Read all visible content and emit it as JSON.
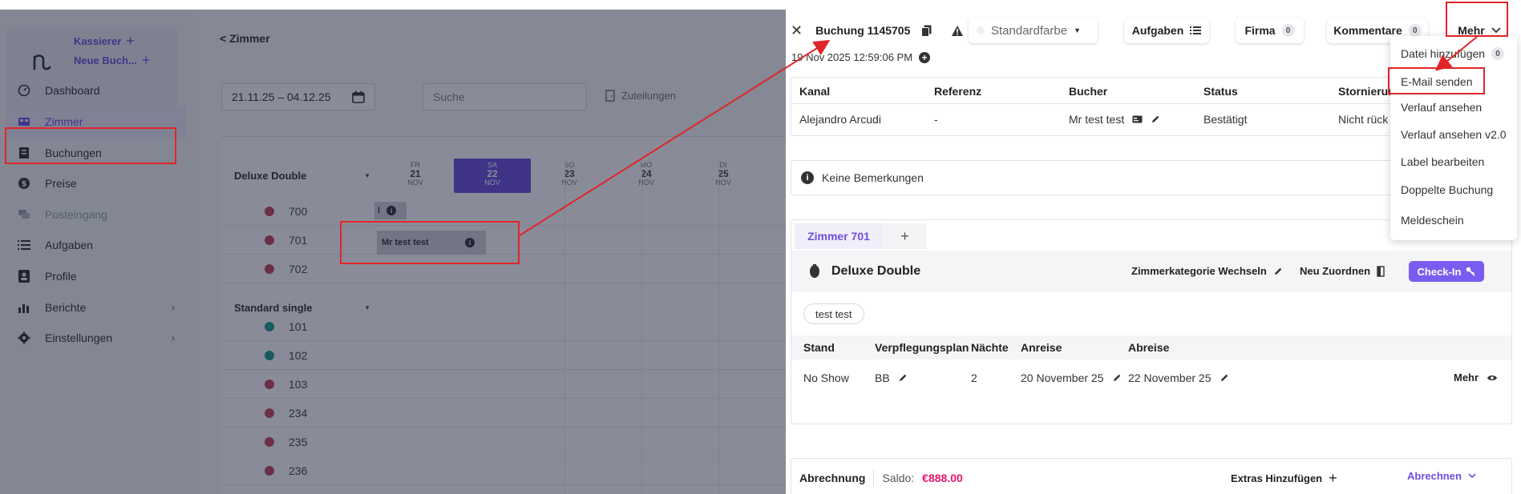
{
  "sidebar": {
    "quick_actions": [
      {
        "label": "Kassierer"
      },
      {
        "label": "Neue Buch..."
      }
    ],
    "items": [
      {
        "label": "Dashboard",
        "icon": "gauge-icon"
      },
      {
        "label": "Zimmer",
        "icon": "bed-icon"
      },
      {
        "label": "Buchungen",
        "icon": "ledger-icon"
      },
      {
        "label": "Preise",
        "icon": "dollar-coin-icon"
      },
      {
        "label": "Posteingang",
        "icon": "chat-bubbles-icon"
      },
      {
        "label": "Aufgaben",
        "icon": "list-icon"
      },
      {
        "label": "Profile",
        "icon": "contact-card-icon"
      },
      {
        "label": "Berichte",
        "icon": "bar-chart-icon"
      },
      {
        "label": "Einstellungen",
        "icon": "gear-icon"
      }
    ]
  },
  "calendar": {
    "back_label": "< Zimmer",
    "date_range": "21.11.25 – 04.12.25",
    "search_placeholder": "Suche",
    "assignments_label": "Zuteilungen",
    "days": [
      {
        "weekday": "FR",
        "day": "21",
        "month": "NOV"
      },
      {
        "weekday": "SA",
        "day": "22",
        "month": "NOV"
      },
      {
        "weekday": "SO",
        "day": "23",
        "month": "NOV"
      },
      {
        "weekday": "MO",
        "day": "24",
        "month": "NOV"
      },
      {
        "weekday": "DI",
        "day": "25",
        "month": "NOV"
      }
    ],
    "categories": [
      {
        "name": "Deluxe Double",
        "rooms": [
          "700",
          "701",
          "702"
        ]
      },
      {
        "name": "Standard single",
        "rooms": [
          "101",
          "102",
          "103",
          "234",
          "235",
          "236"
        ]
      }
    ],
    "small_bar_label": "I",
    "booking_bar_label": "Mr test test",
    "colors": {
      "dirty": "#c2475d",
      "clean": "#1b9c8f",
      "accent": "#6d4fe0"
    }
  },
  "drawer": {
    "title": "Buchung 1145705",
    "color_select": "Standardfarbe",
    "tasks_label": "Aufgaben",
    "company_label": "Firma",
    "company_count": "0",
    "comments_label": "Kommentare",
    "comments_count": "0",
    "more_label": "Mehr",
    "timestamp": "19 Nov 2025 12:59:06 PM",
    "table": {
      "headers": [
        "Kanal",
        "Referenz",
        "Bucher",
        "Status",
        "Stornierung"
      ],
      "row": [
        "Alejandro Arcudi",
        "-",
        "Mr test test",
        "Bestätigt",
        "Nicht rück"
      ]
    },
    "remarks": "Keine Bemerkungen",
    "room_tab": "Zimmer 701",
    "room_category": "Deluxe Double",
    "change_category_label": "Zimmerkategorie Wechseln",
    "reassign_label": "Neu Zuordnen",
    "checkin_label": "Check-In",
    "guest_chip": "test test",
    "stay": {
      "headers": [
        "Stand",
        "Verpflegungsplan",
        "Nächte",
        "Anreise",
        "Abreise"
      ],
      "row": [
        "No Show",
        "BB",
        "2",
        "20 November 25",
        "22 November 25"
      ],
      "more_label": "Mehr"
    },
    "billing": {
      "label": "Abrechnung",
      "balance_label": "Saldo:",
      "balance_value": "€888.00",
      "extras_label": "Extras Hinzufügen",
      "settle_label": "Abrechnen"
    },
    "balance_color": "#e0186c"
  },
  "menu": {
    "items": [
      {
        "label": "Datei hinzufügen",
        "badge": "0"
      },
      {
        "label": "E-Mail senden"
      },
      {
        "label": "Verlauf ansehen"
      },
      {
        "label": "Verlauf ansehen v2.0"
      },
      {
        "label": "Label bearbeiten"
      },
      {
        "label": "Doppelte Buchung"
      },
      {
        "label": "Meldeschein"
      }
    ]
  }
}
